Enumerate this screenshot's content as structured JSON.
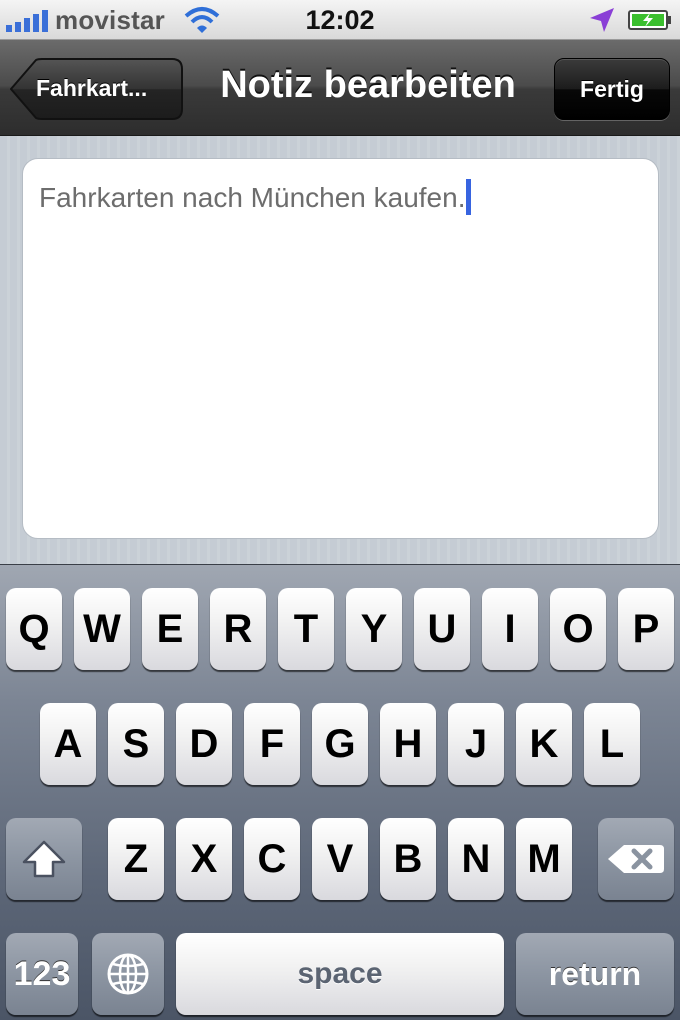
{
  "status_bar": {
    "carrier": "movistar",
    "time": "12:02",
    "signal_icon": "signal-bars-icon",
    "wifi_icon": "wifi-icon",
    "location_icon": "location-arrow-icon",
    "battery_icon": "battery-charging-icon"
  },
  "nav_bar": {
    "back_label": "Fahrkart...",
    "title": "Notiz bearbeiten",
    "done_label": "Fertig"
  },
  "note": {
    "text": "Fahrkarten nach München kaufen."
  },
  "keyboard": {
    "row1": [
      "Q",
      "W",
      "E",
      "R",
      "T",
      "Y",
      "U",
      "I",
      "O",
      "P"
    ],
    "row2": [
      "A",
      "S",
      "D",
      "F",
      "G",
      "H",
      "J",
      "K",
      "L"
    ],
    "row3": [
      "Z",
      "X",
      "C",
      "V",
      "B",
      "N",
      "M"
    ],
    "numbers_label": "123",
    "space_label": "space",
    "return_label": "return",
    "shift_icon": "shift-icon",
    "globe_icon": "globe-icon",
    "delete_icon": "backspace-icon"
  },
  "colors": {
    "caret": "#3764e0",
    "signal": "#3a6fd8",
    "location": "#8a3fd6",
    "battery": "#3bbf2e"
  }
}
